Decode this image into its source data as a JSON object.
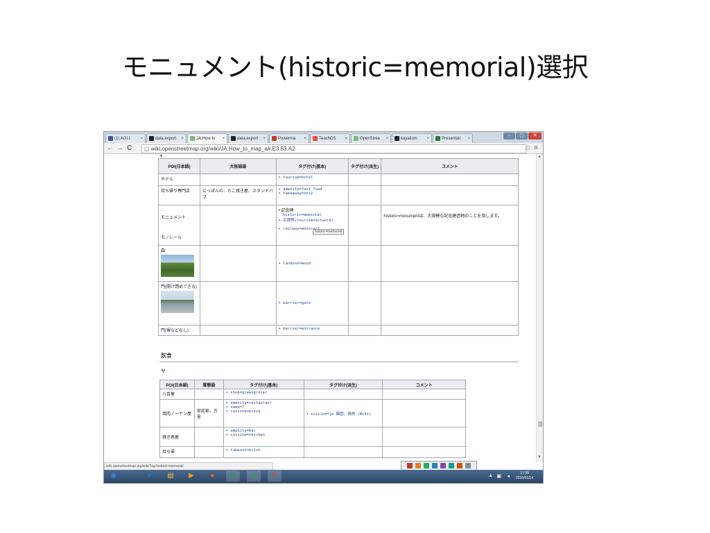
{
  "slide": {
    "title": "モニュメント(historic=memorial)選択"
  },
  "browser": {
    "tabs": [
      {
        "label": "(1) AGI.I.",
        "icon_color": "#3b5998",
        "active": false
      },
      {
        "label": "data.export",
        "icon_color": "#222222",
        "active": false
      },
      {
        "label": "JA:How to",
        "icon_color": "#7ebc6f",
        "active": true
      },
      {
        "label": "data.export",
        "icon_color": "#222222",
        "active": false
      },
      {
        "label": "Powerma",
        "icon_color": "#c0392b",
        "active": false
      },
      {
        "label": "TeachOS",
        "icon_color": "#e74c3c",
        "active": false
      },
      {
        "label": "OpenStree",
        "icon_color": "#7ebc6f",
        "active": false
      },
      {
        "label": "kayakom",
        "icon_color": "#222222",
        "active": false
      },
      {
        "label": "Presentati",
        "icon_color": "#2e7d32",
        "active": false
      }
    ],
    "toolbar": {
      "back": "←",
      "forward": "→",
      "reload": "C",
      "page_icon": "▢",
      "url": "wiki.openstreetmap.org/wiki/JA:How_to_map_a#.E3.83.A2",
      "star": "☆",
      "menu": "≡"
    }
  },
  "wiki": {
    "top_fragment": "+",
    "table1": {
      "headers": [
        "POI(日本語)",
        "大阪語語",
        "タグ付け(基本)",
        "タグ付け(派生)",
        "コメント"
      ],
      "rows": [
        {
          "poi": "ホテル",
          "local": "",
          "tags": [
            "tourism=hotel"
          ],
          "derived": "",
          "comment": ""
        },
        {
          "poi": "持ち帰り専門店",
          "local": "にっぽんの、たこ焼き屋、スタンドバ ブ",
          "tags": [
            "amenity=fast_food",
            "takeaway=only"
          ],
          "derived": "",
          "comment": ""
        },
        {
          "poi": "モニュメント",
          "poi2": "モノレール",
          "local": "",
          "tags_mixed": [
            "記念碑",
            "historic=memorial",
            "石碑等(tourism=artwork)",
            "railway=monorail"
          ],
          "derived": "",
          "comment": "historic=monumentは、大規模な記念建造物のことを指します。"
        },
        {
          "poi": "森",
          "photo": "mountain",
          "local": "",
          "tags": [
            "landuse=wood"
          ],
          "derived": "",
          "comment": ""
        },
        {
          "poi": "門(開け閉めできる)",
          "photo": "gate",
          "local": "",
          "tags": [
            "barrier=gate"
          ],
          "derived": "",
          "comment": ""
        },
        {
          "poi": "門(塀などなし)",
          "local": "",
          "tags": [
            "barrier=entrance"
          ],
          "derived": "",
          "comment": ""
        }
      ]
    },
    "tooltip": "historic=memorial",
    "section_heading": "飲食",
    "subheading": "ヤ",
    "table2": {
      "headers": [
        "POI(日本語)",
        "業態語",
        "タグ付け(基本)",
        "タグ付け(派生)",
        "コメント"
      ],
      "rows": [
        {
          "poi": "八百屋",
          "local": "",
          "tags": [
            "shop=greengrocer"
          ],
          "derived": "",
          "comment": ""
        },
        {
          "poi": "焼肉ノーヤン屋",
          "local": "宮廷家、万里",
          "tags": [
            "amenity=restaurant",
            "name=?",
            "cuisine=pizza"
          ],
          "derived": "cuisine=ja 韓国、焼肉 (Wiki)",
          "comment": ""
        },
        {
          "poi": "焼き鳥屋",
          "local": "",
          "tags": [
            "amenity=bar",
            "cuisine=chicken"
          ],
          "derived": "",
          "comment": ""
        },
        {
          "poi": "持ち帰",
          "local": "",
          "tags": [
            "takeout=kitch"
          ],
          "derived": "",
          "comment": ""
        }
      ]
    }
  },
  "status_url": "wiki.openstreetmap.org/wiki/Tag:historic=memorial",
  "taskbar": {
    "buttons": [
      {
        "name": "start-orb",
        "glyph": "◉",
        "color": "#3a8ad6"
      },
      {
        "name": "ie",
        "glyph": "e",
        "color": "#1e88e5"
      },
      {
        "name": "explorer",
        "glyph": "▤",
        "color": "#f0c040"
      },
      {
        "name": "media",
        "glyph": "▶",
        "color": "#f39c12"
      },
      {
        "name": "firefox",
        "glyph": "●",
        "color": "#e8691b"
      },
      {
        "name": "chrome1",
        "glyph": "◍",
        "color": "#2e9d4a"
      },
      {
        "name": "chrome2",
        "glyph": "◍",
        "color": "#2e9d4a"
      },
      {
        "name": "powerpoint",
        "glyph": "P",
        "color": "#d24726"
      }
    ],
    "clock_time": "17:39",
    "clock_date": "2016/01/14"
  }
}
